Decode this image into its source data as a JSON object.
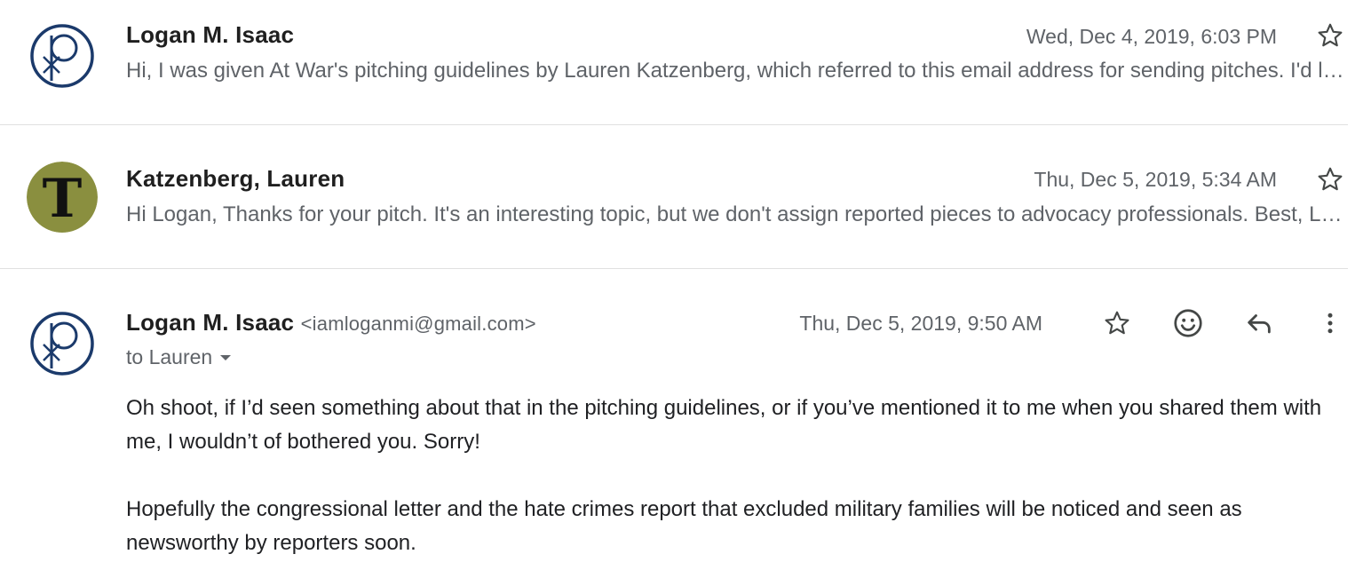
{
  "messages": [
    {
      "sender": "Logan M. Isaac",
      "date": "Wed, Dec 4, 2019, 6:03 PM",
      "snippet": "Hi, I was given At War's pitching guidelines by Lauren Katzenberg, which referred to this email address for sending pitches. I'd like to pitch a story"
    },
    {
      "sender": "Katzenberg, Lauren",
      "date": "Thu, Dec 5, 2019, 5:34 AM",
      "snippet": "Hi Logan, Thanks for your pitch. It's an interesting topic, but we don't assign reported pieces to advocacy professionals. Best, Lauren"
    },
    {
      "sender": "Logan M. Isaac",
      "sender_email": "<iamloganmi@gmail.com>",
      "date": "Thu, Dec 5, 2019, 9:50 AM",
      "to": "to Lauren",
      "body": [
        "Oh shoot, if I’d seen something about that in the pitching guidelines, or if you’ve mentioned it to me when you shared them with me, I wouldn’t of bothered you. Sorry!",
        "Hopefully the congressional letter and the hate crimes report that excluded military families will be noticed and seen as newsworthy by reporters soon."
      ]
    }
  ],
  "icons": {
    "star": "star-icon",
    "emoji": "emoji-reaction-icon",
    "reply": "reply-icon",
    "more": "more-vert-icon",
    "dropdown": "dropdown-arrow-icon"
  },
  "colors": {
    "avatar_ring": "#1b3a6b",
    "nyt_avatar_bg": "#8a8f3f",
    "muted_text": "#5f6368",
    "divider": "#e0e0e0"
  }
}
